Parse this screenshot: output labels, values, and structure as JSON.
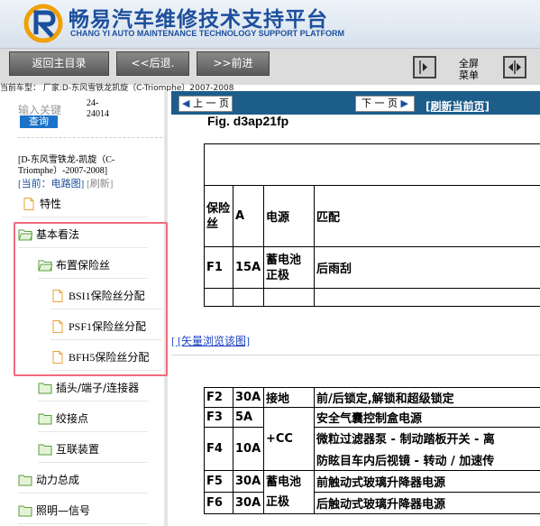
{
  "header": {
    "title_cn": "畅易汽车维修技术支持平台",
    "title_en": "CHANG YI AUTO MAINTENANCE TECHNOLOGY SUPPORT PLATFORM"
  },
  "toolbar": {
    "home_label": "返回主目录",
    "back_label": "<<后退.",
    "forward_label": ">>前进",
    "fullmenu_label": "全屏\n菜单"
  },
  "vehicle_line": "当前车型： 厂家:D-东风雪铁龙凯旋（C-Triomphe）2007-2008",
  "sidebar": {
    "search_label": "输入关键",
    "query_label": "查询",
    "code_text": "24-\n24014",
    "vehicle_title": "[D-东风雪铁龙-凯旋（C-Triomphe）-2007-2008]",
    "current_prefix": "[当前：电路图]",
    "refresh_label": "[刷新]",
    "tree": [
      {
        "label": "特性",
        "type": "file"
      },
      {
        "label": "基本看法",
        "type": "folder"
      },
      {
        "label": "布置保险丝",
        "type": "folder"
      },
      {
        "label": "BSI1保险丝分配",
        "type": "file"
      },
      {
        "label": "PSF1保险丝分配",
        "type": "file"
      },
      {
        "label": "BFH5保险丝分配",
        "type": "file"
      },
      {
        "label": "插头/端子/连接器",
        "type": "folder"
      },
      {
        "label": "绞接点",
        "type": "folder"
      },
      {
        "label": "互联装置",
        "type": "folder"
      },
      {
        "label": "动力总成",
        "type": "folder"
      },
      {
        "label": "照明—信号",
        "type": "folder"
      }
    ]
  },
  "content": {
    "prev_label": "上 一 页",
    "next_label": "下 一 页",
    "refresh_link": "[刷新当前页]",
    "fig_caption": "Fig. d3ap21fp",
    "vector_link": "[ [矢量浏览该图]",
    "table1": {
      "headers": [
        "保险丝",
        "A",
        "电源",
        "匹配"
      ],
      "rows": [
        [
          "F1",
          "15A",
          "蓄电池正极",
          "后雨刮"
        ]
      ]
    },
    "table2": {
      "rows": [
        [
          "F2",
          "30A",
          "接地",
          "前/后锁定,解锁和超级锁定"
        ],
        [
          "F3",
          "5A",
          "+CC",
          "安全气囊控制盒电源"
        ],
        [
          "F4",
          "10A",
          "",
          "微粒过滤器泵 - 制动踏板开关 - 离"
        ],
        [
          "",
          "",
          "",
          "防眩目车内后视镜 - 转动 / 加速传"
        ],
        [
          "F5",
          "30A",
          "蓄电池正极",
          "前触动式玻璃升降器电源"
        ],
        [
          "F6",
          "30A",
          "",
          "后触动式玻璃升降器电源"
        ]
      ]
    }
  },
  "colors": {
    "brand_blue": "#1c4f9c",
    "content_bar": "#1d5d8a",
    "highlight": "#f06a7c",
    "query_button": "#1a73c8"
  }
}
